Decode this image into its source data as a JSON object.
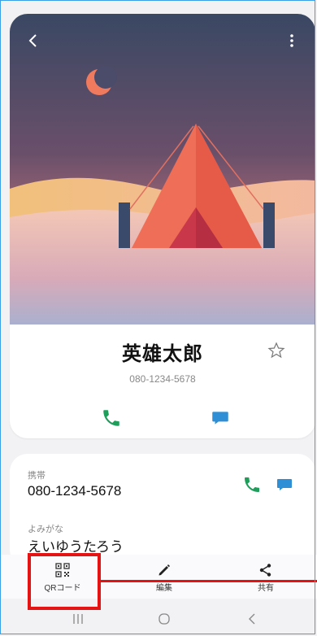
{
  "contact": {
    "name": "英雄太郎",
    "phone_display": "080-1234-5678"
  },
  "details": {
    "mobile_label": "携帯",
    "mobile_value": "080-1234-5678",
    "reading_label": "よみがな",
    "reading_value": "えいゆうたろう"
  },
  "toolbar": {
    "qr_label": "QRコード",
    "edit_label": "編集",
    "share_label": "共有"
  },
  "colors": {
    "call_green": "#1e9e5a",
    "message_blue": "#2f8fd6",
    "highlight_red": "#e41414"
  }
}
